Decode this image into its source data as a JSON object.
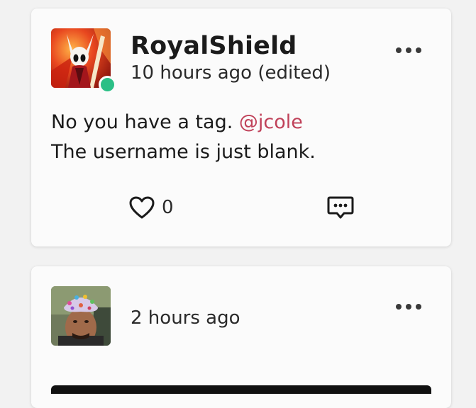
{
  "posts": [
    {
      "username": "RoyalShield",
      "timestamp": "10 hours ago (edited)",
      "online": true,
      "avatar_icon": "hornet-avatar",
      "body_line1_text": "No you have a tag. ",
      "body_line1_mention": "@jcole",
      "body_line2": "The username is just blank.",
      "like_count": "0"
    },
    {
      "username": "",
      "timestamp": "2 hours ago",
      "avatar_icon": "man-with-shower-cap-avatar"
    }
  ],
  "colors": {
    "mention": "#c0425a",
    "online": "#2bbf86",
    "card_bg": "#fbfbfb"
  }
}
